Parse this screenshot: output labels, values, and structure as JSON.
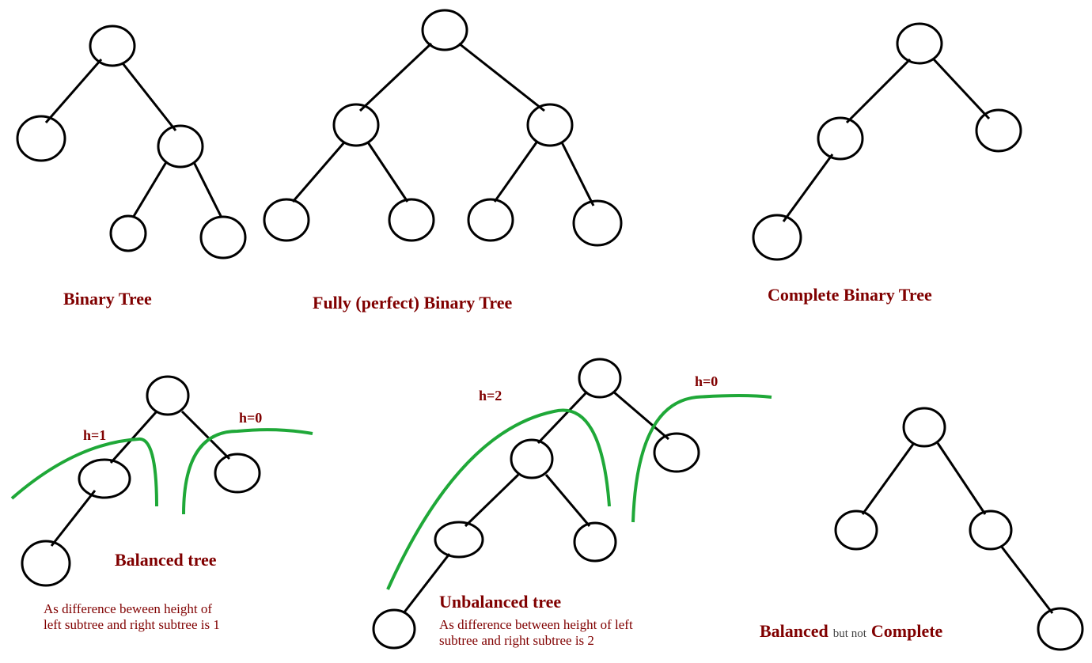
{
  "diagrams": {
    "binary_tree": {
      "label": "Binary Tree"
    },
    "full_tree": {
      "label": "Fully (perfect) Binary Tree"
    },
    "complete_tree": {
      "label": "Complete Binary Tree"
    },
    "balanced_tree": {
      "label": "Balanced tree",
      "h_left": "h=1",
      "h_right": "h=0",
      "note": "As difference beween height of\nleft subtree and right subtree is 1"
    },
    "unbalanced_tree": {
      "label": "Unbalanced tree",
      "h_left": "h=2",
      "h_right": "h=0",
      "note": "As difference between height of left\nsubtree and right subtree is 2"
    },
    "balanced_not_complete": {
      "label_part1": "Balanced",
      "label_mid": "but not",
      "label_part2": "Complete"
    }
  }
}
